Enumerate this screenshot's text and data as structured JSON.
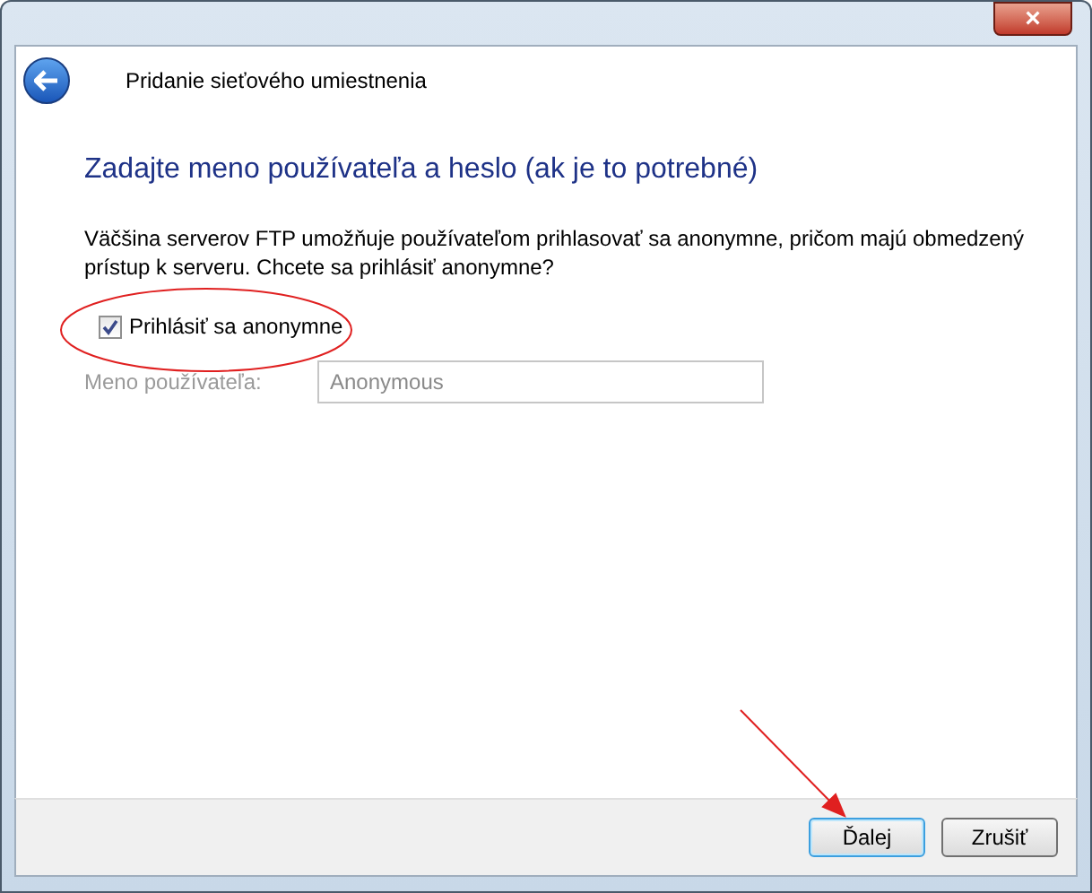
{
  "window": {
    "title": "Pridanie sieťového umiestnenia",
    "close_button": "×"
  },
  "page": {
    "heading": "Zadajte meno používateľa a heslo (ak je to potrebné)",
    "description": "Väčšina serverov FTP umožňuje používateľom prihlasovať sa anonymne, pričom majú obmedzený prístup k serveru. Chcete sa prihlásiť anonymne?",
    "anonymous_checkbox": {
      "label": "Prihlásiť sa anonymne",
      "checked": true
    },
    "username": {
      "label": "Meno používateľa:",
      "value": "Anonymous",
      "disabled": true
    }
  },
  "buttons": [
    {
      "label": "Ďalej",
      "selected": true
    },
    {
      "label": "Zrušiť",
      "selected": false
    }
  ]
}
